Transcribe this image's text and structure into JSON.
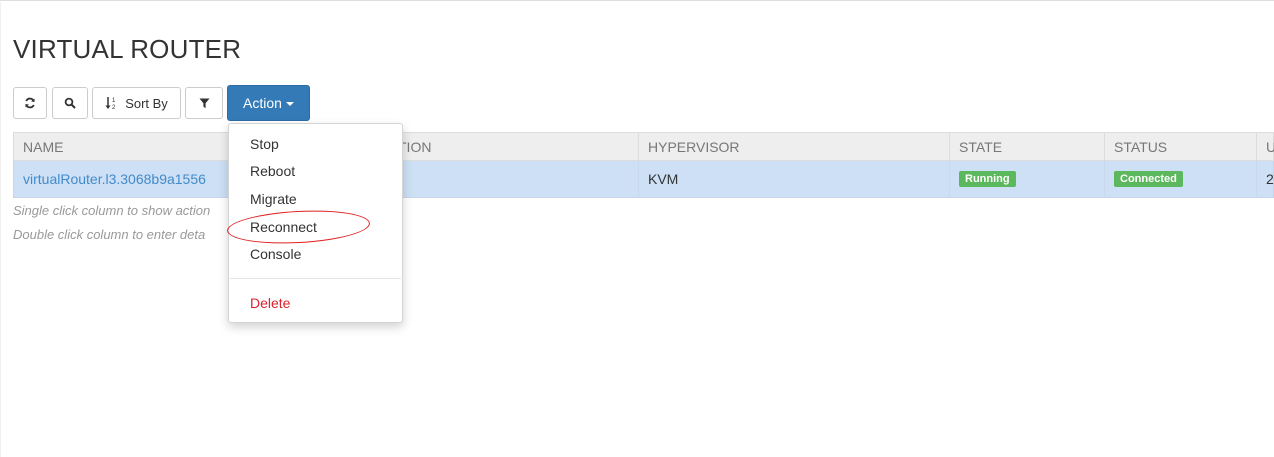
{
  "page": {
    "title": "VIRTUAL ROUTER"
  },
  "toolbar": {
    "refresh_icon": "refresh-icon",
    "search_icon": "search-icon",
    "sort_label": "Sort By",
    "sort_icon": "sort-numeric-icon",
    "filter_icon": "filter-icon",
    "action_label": "Action"
  },
  "table": {
    "columns": [
      "NAME",
      "TION",
      "HYPERVISOR",
      "STATE",
      "STATUS",
      "U"
    ],
    "rows": [
      {
        "name": "virtualRouter.l3.3068b9a1556",
        "hypervisor": "KVM",
        "state": "Running",
        "status": "Connected",
        "extra": "2"
      }
    ]
  },
  "hints": {
    "single": "Single click column to show action",
    "double": "Double click column to enter deta"
  },
  "action_menu": {
    "items": [
      "Stop",
      "Reboot",
      "Migrate",
      "Reconnect",
      "Console"
    ],
    "danger_item": "Delete"
  },
  "colors": {
    "primary": "#337ab7",
    "success": "#5cb85c",
    "danger": "#d9232e",
    "row_selected": "#cde0f5",
    "annotation": "#e02020"
  }
}
